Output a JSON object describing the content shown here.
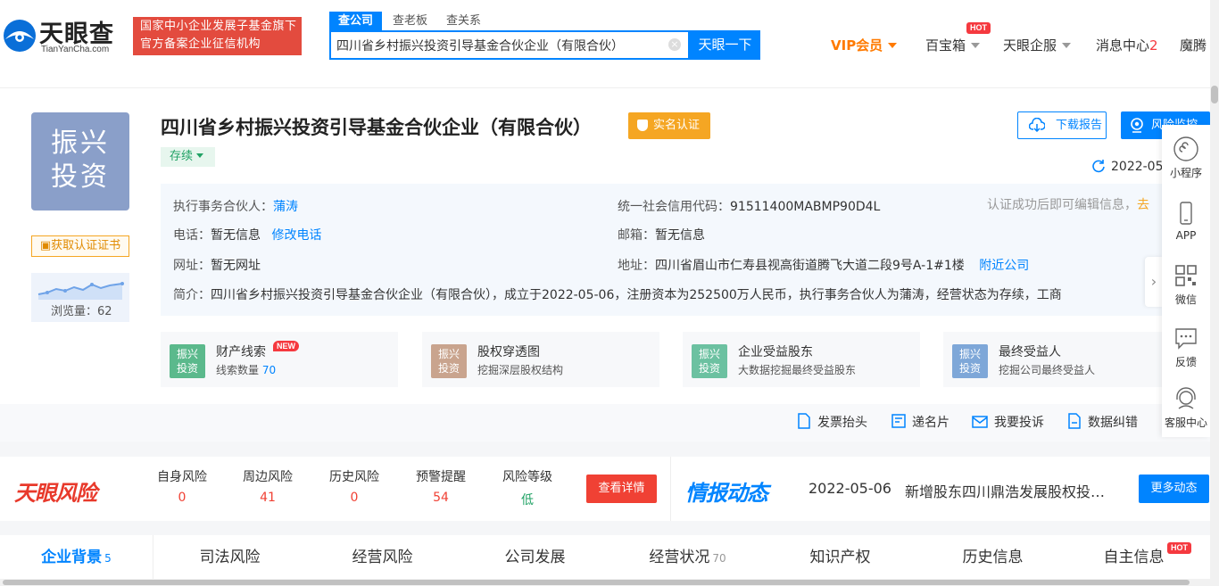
{
  "header": {
    "logo_cn": "天眼查",
    "logo_en": "TianYanCha.com",
    "fund_badge_line1": "国家中小企业发展子基金旗下",
    "fund_badge_line2": "官方备案企业征信机构",
    "search_tabs": [
      "查公司",
      "查老板",
      "查关系"
    ],
    "search_value": "四川省乡村振兴投资引导基金合伙企业（有限合伙）",
    "search_button": "天眼一下",
    "nav": {
      "vip": "VIP会员",
      "treasure": "百宝箱",
      "treasure_tag": "HOT",
      "enterprise": "天眼企服",
      "messages": "消息中心",
      "messages_count": "2",
      "user": "魔腾"
    }
  },
  "company": {
    "avatar_line1": "振兴",
    "avatar_line2": "投资",
    "name": "四川省乡村振兴投资引导基金合伙企业（有限合伙）",
    "verified_label": "实名认证",
    "status": "存续",
    "cert_link": "获取认证证书",
    "views_label": "浏览量：",
    "views": "62",
    "download_report": "下载报告",
    "risk_monitor": "风险监控",
    "update_date": "2022-05",
    "info": {
      "partner_label": "执行事务合伙人：",
      "partner": "蒲涛",
      "credit_code_label": "统一社会信用代码：",
      "credit_code": "91511400MABMP90D4L",
      "edit_hint": "认证成功后即可编辑信息，",
      "edit_link": "去",
      "phone_label": "电话：",
      "phone": "暂无信息",
      "phone_edit": "修改电话",
      "email_label": "邮箱：",
      "email": "暂无信息",
      "website_label": "网址：",
      "website": "暂无网址",
      "address_label": "地址：",
      "address": "四川省眉山市仁寿县视高街道腾飞大道二段9号A-1#1楼",
      "nearby": "附近公司",
      "intro_label": "简介：",
      "intro": "四川省乡村振兴投资引导基金合伙企业（有限合伙），成立于2022-05-06，注册资本为252500万人民币，执行事务合伙人为蒲涛，经营状态为存续，工商"
    },
    "features": [
      {
        "icon": "振兴投资",
        "title": "财产线索",
        "tag": "NEW",
        "sub": "线索数量",
        "num": "70",
        "color": "#5bb98c"
      },
      {
        "icon": "振兴投资",
        "title": "股权穿透图",
        "tag": "",
        "sub": "挖掘深层股权结构",
        "num": "",
        "color": "#c9a48e"
      },
      {
        "icon": "振兴投资",
        "title": "企业受益股东",
        "tag": "",
        "sub": "大数据挖掘最终受益股东",
        "num": "",
        "color": "#6cc1a1"
      },
      {
        "icon": "振兴投资",
        "title": "最终受益人",
        "tag": "",
        "sub": "挖掘公司最终受益人",
        "num": "",
        "color": "#7ea7d8"
      }
    ]
  },
  "actions": [
    "发票抬头",
    "递名片",
    "我要投诉",
    "数据纠错",
    "客服中心"
  ],
  "risk": {
    "logo": "天眼风险",
    "items": [
      {
        "label": "自身风险",
        "value": "0"
      },
      {
        "label": "周边风险",
        "value": "41"
      },
      {
        "label": "历史风险",
        "value": "0"
      },
      {
        "label": "预警提醒",
        "value": "54"
      },
      {
        "label": "风险等级",
        "value": "低"
      }
    ],
    "details_button": "查看详情",
    "intel_logo": "情报动态",
    "intel_date": "2022-05-06",
    "intel_text": "新增股东四川鼎浩发展股权投资基金管理有限公司",
    "more_button": "更多动态"
  },
  "tabs": [
    {
      "label": "企业背景",
      "count": "5"
    },
    {
      "label": "司法风险",
      "count": ""
    },
    {
      "label": "经营风险",
      "count": ""
    },
    {
      "label": "公司发展",
      "count": ""
    },
    {
      "label": "经营状况",
      "count": "70"
    },
    {
      "label": "知识产权",
      "count": ""
    },
    {
      "label": "历史信息",
      "count": ""
    },
    {
      "label": "自主信息",
      "count": "",
      "tag": "HOT"
    }
  ],
  "floatbar": [
    "小程序",
    "APP",
    "微信",
    "反馈",
    "客服中心"
  ]
}
